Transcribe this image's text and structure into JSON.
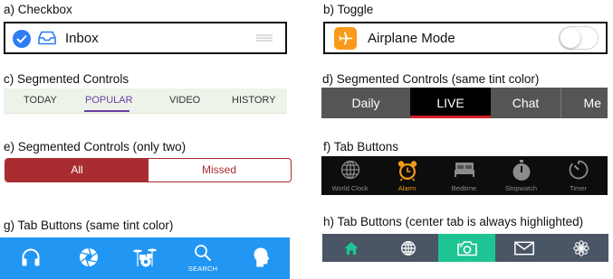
{
  "captions": {
    "a": "a) Checkbox",
    "b": "b) Toggle",
    "c": "c) Segmented Controls",
    "d": "d) Segmented Controls (same tint color)",
    "e": "e) Segmented Controls (only two)",
    "f": "f) Tab Buttons",
    "g": "g) Tab Buttons (same tint color)",
    "h": "h) Tab Buttons (center tab is always highlighted)"
  },
  "checkbox": {
    "label": "Inbox",
    "checked": true,
    "icons": [
      "checkmark-icon",
      "inbox-tray-icon",
      "drag-handle-icon"
    ]
  },
  "toggle": {
    "label": "Airplane Mode",
    "on": false,
    "icons": [
      "airplane-icon"
    ]
  },
  "segmented_c": {
    "items": [
      "TODAY",
      "POPULAR",
      "VIDEO",
      "HISTORY"
    ],
    "selected": "POPULAR"
  },
  "segmented_d": {
    "items": [
      "Daily",
      "LIVE",
      "Chat",
      "Me"
    ],
    "selected": "LIVE"
  },
  "segmented_e": {
    "items": [
      "All",
      "Missed"
    ],
    "selected": "All"
  },
  "tabs_f": {
    "items": [
      {
        "label": "World Clock",
        "icon": "globe-icon"
      },
      {
        "label": "Alarm",
        "icon": "alarm-clock-icon"
      },
      {
        "label": "Bedtime",
        "icon": "bed-icon"
      },
      {
        "label": "Stopwatch",
        "icon": "stopwatch-icon"
      },
      {
        "label": "Timer",
        "icon": "timer-icon"
      }
    ],
    "selected": "Alarm"
  },
  "tabs_g": {
    "items": [
      {
        "label": "",
        "icon": "headphones-icon"
      },
      {
        "label": "",
        "icon": "aperture-icon"
      },
      {
        "label": "",
        "icon": "drum-kit-icon"
      },
      {
        "label": "SEARCH",
        "icon": "search-icon"
      },
      {
        "label": "",
        "icon": "head-profile-icon"
      }
    ],
    "selected": "SEARCH"
  },
  "tabs_h": {
    "items": [
      {
        "icon": "home-icon"
      },
      {
        "icon": "globe-icon"
      },
      {
        "icon": "camera-icon"
      },
      {
        "icon": "mail-icon"
      },
      {
        "icon": "flower-icon"
      }
    ],
    "highlighted_index": 2
  },
  "colors": {
    "checkbox_blue": "#2e7cf6",
    "toggle_orange": "#fb9a1a",
    "segment_purple": "#6b3fa0",
    "segment_red_underline": "#d1202b",
    "segment_two_red": "#a92c30",
    "tab_active_orange": "#f19a1a",
    "tab_blue": "#2196f3",
    "tab_center_green": "#1ec493",
    "tab_slate": "#4a5566"
  }
}
